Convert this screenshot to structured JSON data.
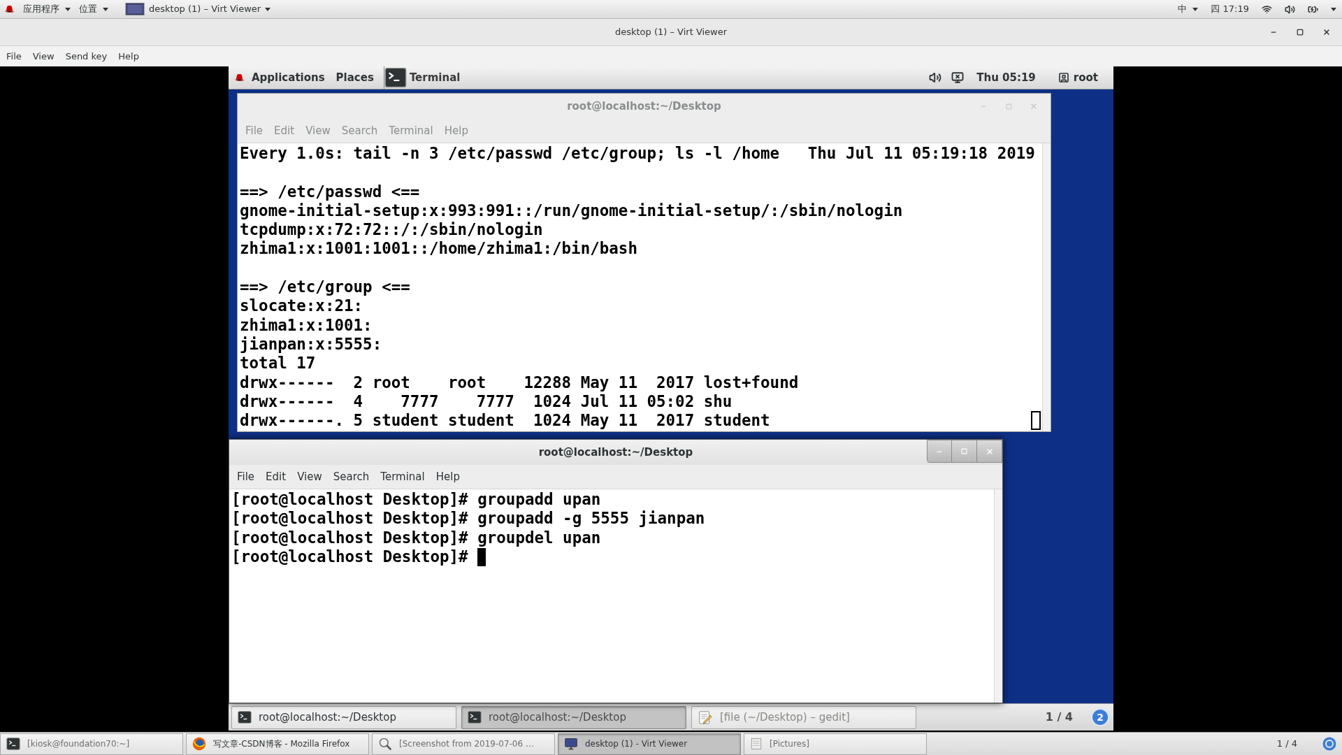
{
  "host_top_bar": {
    "menus": [
      "应用程序",
      "位置"
    ],
    "window_menu": "desktop (1) – Virt Viewer",
    "input_method": "中",
    "clock": "四 17:19"
  },
  "window": {
    "title": "desktop (1) – Virt Viewer",
    "menu": [
      "File",
      "View",
      "Send key",
      "Help"
    ]
  },
  "guest": {
    "top_bar": {
      "menus": [
        "Applications",
        "Places"
      ],
      "app": "Terminal",
      "clock": "Thu 05:19",
      "user": "root"
    },
    "terminals": [
      {
        "title": "root@localhost:~/Desktop",
        "focused": false,
        "menu": [
          "File",
          "Edit",
          "View",
          "Search",
          "Terminal",
          "Help"
        ],
        "blocks": [
          [
            "Every 1.0s: tail -n 3 /etc/passwd /etc/group; ls -l /home   Thu Jul 11 05:19:18 2019"
          ],
          [
            "==> /etc/passwd <==",
            "gnome-initial-setup:x:993:991::/run/gnome-initial-setup/:/sbin/nologin",
            "tcpdump:x:72:72::/:/sbin/nologin",
            "zhima1:x:1001:1001::/home/zhima1:/bin/bash"
          ],
          [
            "==> /etc/group <==",
            "slocate:x:21:",
            "zhima1:x:1001:",
            "jianpan:x:5555:",
            "total 17",
            "drwx------  2 root    root    12288 May 11  2017 lost+found",
            "drwx------  4    7777    7777  1024 Jul 11 05:02 shu",
            "drwx------. 5 student student  1024 May 11  2017 student"
          ]
        ]
      },
      {
        "title": "root@localhost:~/Desktop",
        "focused": true,
        "menu": [
          "File",
          "Edit",
          "View",
          "Search",
          "Terminal",
          "Help"
        ],
        "blocks": [
          [
            "[root@localhost Desktop]# groupadd upan",
            "[root@localhost Desktop]# groupadd -g 5555 jianpan",
            "[root@localhost Desktop]# groupdel upan",
            "[root@localhost Desktop]# "
          ]
        ]
      }
    ],
    "taskbar": {
      "items": [
        {
          "label": "root@localhost:~/Desktop",
          "kind": "terminal",
          "selected": false,
          "minimized": false
        },
        {
          "label": "root@localhost:~/Desktop",
          "kind": "terminal",
          "selected": true,
          "minimized": false
        },
        {
          "label": "[file (~/Desktop) – gedit]",
          "kind": "editor",
          "selected": false,
          "minimized": true
        }
      ],
      "workspace": "1 / 4",
      "notifications": "2"
    }
  },
  "host_taskbar": {
    "items": [
      {
        "label": "[kiosk@foundation70:~]",
        "kind": "terminal",
        "selected": false,
        "minimized": true
      },
      {
        "label": "写文章-CSDN博客 - Mozilla Firefox",
        "kind": "browser",
        "selected": false,
        "minimized": false
      },
      {
        "label": "[Screenshot from 2019-07-06 …",
        "kind": "viewer",
        "selected": false,
        "minimized": true
      },
      {
        "label": "desktop (1) - Virt Viewer",
        "kind": "remote",
        "selected": true,
        "minimized": false
      },
      {
        "label": "[Pictures]",
        "kind": "folder",
        "selected": false,
        "minimized": true
      }
    ],
    "workspace": "1 / 4"
  }
}
